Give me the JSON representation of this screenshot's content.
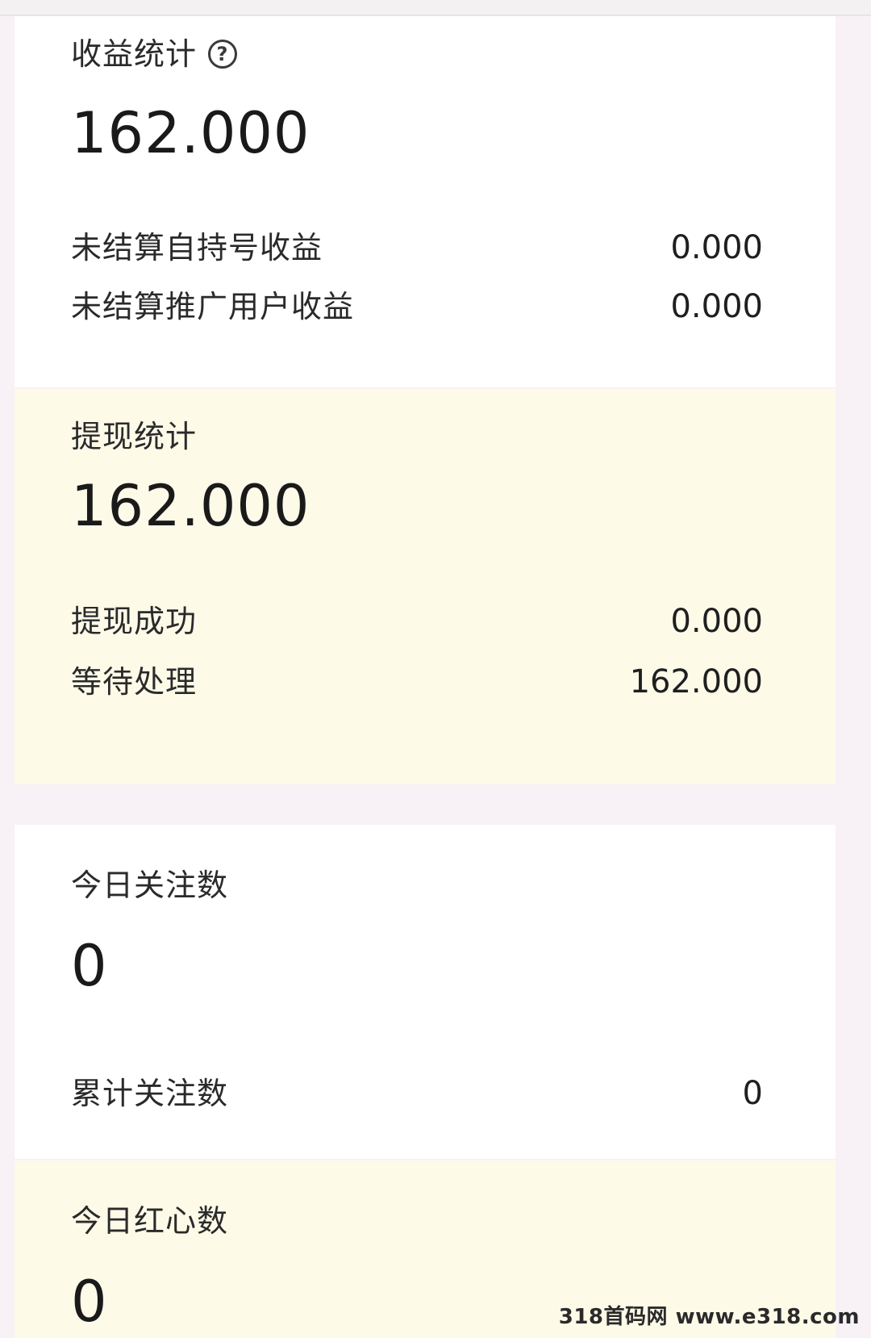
{
  "earnings": {
    "title": "收益统计",
    "help_glyph": "?",
    "total": "162.000",
    "rows": [
      {
        "label": "未结算自持号收益",
        "value": "0.000"
      },
      {
        "label": "未结算推广用户收益",
        "value": "0.000"
      }
    ]
  },
  "withdraw": {
    "title": "提现统计",
    "total": "162.000",
    "rows": [
      {
        "label": "提现成功",
        "value": "0.000"
      },
      {
        "label": "等待处理",
        "value": "162.000"
      }
    ]
  },
  "follows": {
    "title": "今日关注数",
    "today": "0",
    "rows": [
      {
        "label": "累计关注数",
        "value": "0"
      }
    ]
  },
  "hearts": {
    "title": "今日红心数",
    "today": "0"
  },
  "watermark": "318首码网 www.e318.com",
  "colors": {
    "background": "#f8f1f6",
    "card_white": "#ffffff",
    "card_cream": "#fdfae8"
  }
}
